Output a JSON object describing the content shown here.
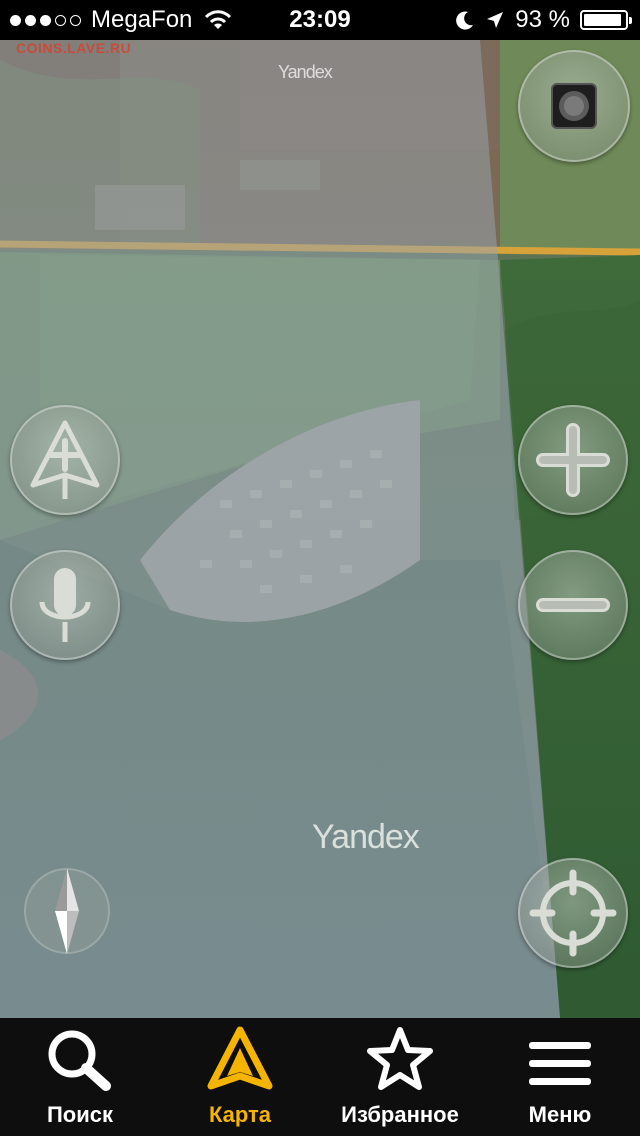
{
  "status_bar": {
    "carrier": "MegaFon",
    "time": "23:09",
    "battery": "93 %",
    "battery_level": 0.93,
    "signal_bars_filled": 3,
    "signal_bars_total": 5
  },
  "map": {
    "watermark_top": "Yandex",
    "watermark_main": "Yandex",
    "site_mark": "COINS.LAVE.RU"
  },
  "controls": {
    "traffic": "traffic-light-icon",
    "route": "route-plus-icon",
    "voice": "microphone-icon",
    "zoom_in": "plus-icon",
    "zoom_out": "minus-icon",
    "locate": "crosshair-icon",
    "compass": "compass-icon"
  },
  "tabs": [
    {
      "label": "Поиск",
      "icon": "search-icon",
      "active": false
    },
    {
      "label": "Карта",
      "icon": "map-arrow-icon",
      "active": true
    },
    {
      "label": "Избранное",
      "icon": "star-icon",
      "active": false
    },
    {
      "label": "Меню",
      "icon": "menu-icon",
      "active": false
    }
  ],
  "colors": {
    "accent": "#f5b400",
    "tabbar_bg": "#0e0e0e",
    "road": "#d7a23a"
  }
}
